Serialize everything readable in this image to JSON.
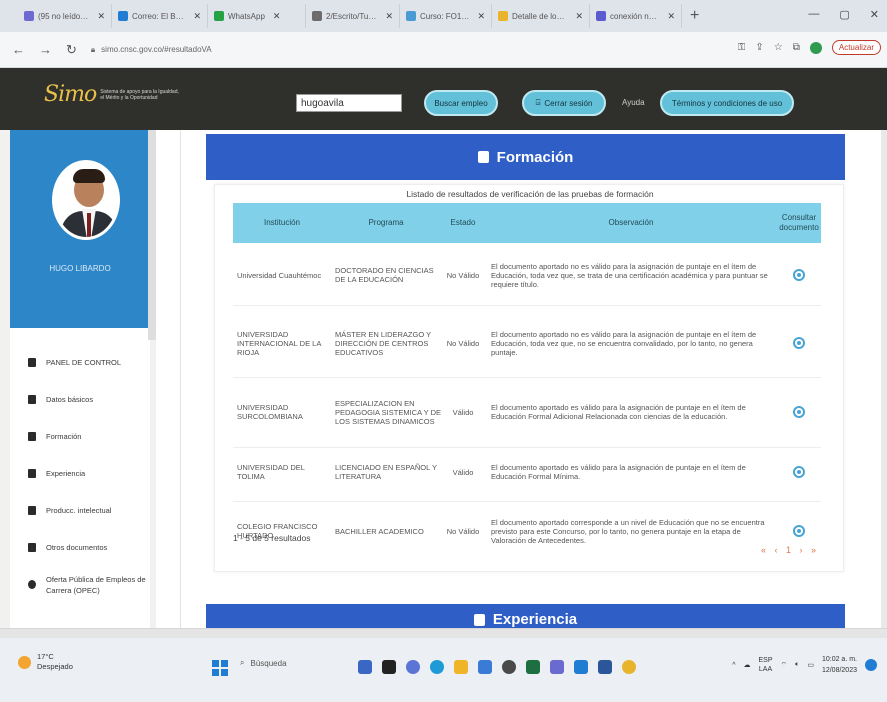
{
  "browser": {
    "tabs": [
      {
        "label": "(95 no leídos) -",
        "color": "#6f6ad0"
      },
      {
        "label": "Correo: El Bardo -",
        "color": "#1f7ed4"
      },
      {
        "label": "WhatsApp",
        "color": "#25a244"
      },
      {
        "label": "2/Escrito/Tutela -",
        "color": "#6c6c6c"
      },
      {
        "label": "Curso: FO13 Diff",
        "color": "#4a9ad4"
      },
      {
        "label": "Detalle de los f...",
        "color": "#e8b42c"
      },
      {
        "label": "conexión nacion...",
        "color": "#5b5bd0"
      }
    ],
    "new_tab": "+",
    "url": "simo.cnsc.gov.co/#resultadoVA",
    "update_label": "Actualizar"
  },
  "site": {
    "logo_mark": "Simo",
    "logo_text": "Sistema de apoyo para la Igualdad, el Mérito y la Oportunidad",
    "username": "hugoavila",
    "buttons": {
      "search_jobs": "Buscar empleo",
      "logout": "Cerrar sesión",
      "terms": "Términos y condiciones de uso"
    },
    "help": "Ayuda"
  },
  "sidebar": {
    "profile_name": "HUGO LIBARDO",
    "items": [
      {
        "label": "PANEL DE CONTROL"
      },
      {
        "label": "Datos básicos"
      },
      {
        "label": "Formación"
      },
      {
        "label": "Experiencia"
      },
      {
        "label": "Producc. intelectual"
      },
      {
        "label": "Otros documentos"
      },
      {
        "label": "Oferta Pública de Empleos de Carrera (OPEC)"
      }
    ]
  },
  "formacion": {
    "title": "Formación",
    "caption": "Listado de resultados de verificación de las pruebas de formación",
    "columns": [
      "Institución",
      "Programa",
      "Estado",
      "Observación",
      "Consultar documento"
    ],
    "rows": [
      {
        "institucion": "Universidad Cuauhtémoc",
        "programa": "Doctorado en ciencias de la educación",
        "estado": "No Válido",
        "observacion": "El documento aportado no es válido para la asignación de puntaje en el ítem de Educación, toda vez que, se trata de una certificación académica y para puntuar se requiere título."
      },
      {
        "institucion": "UNIVERSIDAD INTERNACIONAL DE LA RIOJA",
        "programa": "MÁSTER EN LIDERAZGO Y DIRECCIÓN DE CENTROS EDUCATIVOS",
        "estado": "No Válido",
        "observacion": "El documento aportado no es válido para la asignación de puntaje en el ítem de Educación, toda vez que, no se encuentra convalidado, por lo tanto, no genera puntaje."
      },
      {
        "institucion": "UNIVERSIDAD SURCOLOMBIANA",
        "programa": "ESPECIALIZACION EN PEDAGOGIA SISTEMICA Y DE LOS SISTEMAS DINAMICOS",
        "estado": "Válido",
        "observacion": "El documento aportado es válido para la asignación de puntaje en el ítem de Educación Formal Adicional Relacionada con ciencias de la educación."
      },
      {
        "institucion": "UNIVERSIDAD DEL TOLIMA",
        "programa": "LICENCIADO EN ESPAÑOL Y LITERATURA",
        "estado": "Válido",
        "observacion": "El documento aportado es válido para la asignación de puntaje en el ítem de Educación Formal Mínima."
      },
      {
        "institucion": "COLEGIO FRANCISCO HURTADO",
        "programa": "BACHILLER ACADEMICO",
        "estado": "No Válido",
        "observacion": "El documento aportado corresponde a un nivel de Educación que no se encuentra previsto para este Concurso, por lo tanto, no genera puntaje en la etapa de Valoración de Antecedentes."
      }
    ],
    "results_text": "1 - 5 de 5 resultados",
    "pager": "« ‹ 1 › »"
  },
  "experiencia": {
    "title": "Experiencia"
  },
  "taskbar": {
    "temperature": "17°C",
    "weather": "Despejado",
    "search": "Búsqueda",
    "lang": "ESP",
    "lang2": "LAA",
    "time": "10:02 a. m.",
    "date": "12/08/2023"
  }
}
